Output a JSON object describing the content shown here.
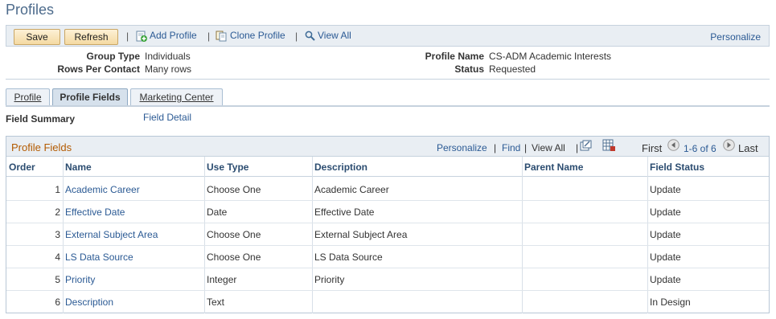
{
  "page": {
    "title": "Profiles"
  },
  "toolbar": {
    "save_label": "Save",
    "refresh_label": "Refresh",
    "add_profile_label": "Add Profile",
    "clone_profile_label": "Clone Profile",
    "view_all_label": "View All",
    "personalize_label": "Personalize",
    "separator": "|"
  },
  "header": {
    "group_type_label": "Group Type",
    "group_type_value": "Individuals",
    "rows_per_contact_label": "Rows Per Contact",
    "rows_per_contact_value": "Many rows",
    "profile_name_label": "Profile Name",
    "profile_name_value": "CS-ADM Academic Interests",
    "status_label": "Status",
    "status_value": "Requested"
  },
  "tabs": [
    {
      "label": "Profile"
    },
    {
      "label": "Profile Fields",
      "active": true
    },
    {
      "label": "Marketing Center"
    }
  ],
  "subnav": {
    "field_summary_label": "Field Summary",
    "field_detail_label": "Field Detail"
  },
  "grid": {
    "title": "Profile Fields",
    "personalize_label": "Personalize",
    "find_label": "Find",
    "view_all_label": "View All",
    "first_label": "First",
    "range_label": "1-6 of 6",
    "last_label": "Last",
    "separator": "|",
    "columns": [
      "Order",
      "Name",
      "Use Type",
      "Description",
      "Parent Name",
      "Field Status"
    ],
    "rows": [
      {
        "order": "1",
        "name": "Academic Career",
        "use_type": "Choose One",
        "description": "Academic Career",
        "parent_name": "",
        "field_status": "Update"
      },
      {
        "order": "2",
        "name": "Effective Date",
        "use_type": "Date",
        "description": "Effective Date",
        "parent_name": "",
        "field_status": "Update"
      },
      {
        "order": "3",
        "name": "External Subject Area",
        "use_type": "Choose One",
        "description": "External Subject Area",
        "parent_name": "",
        "field_status": "Update"
      },
      {
        "order": "4",
        "name": "LS Data Source",
        "use_type": "Choose One",
        "description": "LS Data Source",
        "parent_name": "",
        "field_status": "Update"
      },
      {
        "order": "5",
        "name": "Priority",
        "use_type": "Integer",
        "description": "Priority",
        "parent_name": "",
        "field_status": "Update"
      },
      {
        "order": "6",
        "name": "Description",
        "use_type": "Text",
        "description": "",
        "parent_name": "",
        "field_status": "In Design"
      }
    ]
  },
  "icons": {
    "add": "add-profile-icon",
    "clone": "clone-profile-icon",
    "view_all": "magnifier-icon",
    "new_window": "new-window-icon",
    "download": "download-grid-icon",
    "prev": "previous-arrow-icon",
    "next": "next-arrow-icon"
  },
  "colors": {
    "grid_title": "#b35a00",
    "link": "#2b5a94",
    "header_bg": "#e9eef3"
  }
}
